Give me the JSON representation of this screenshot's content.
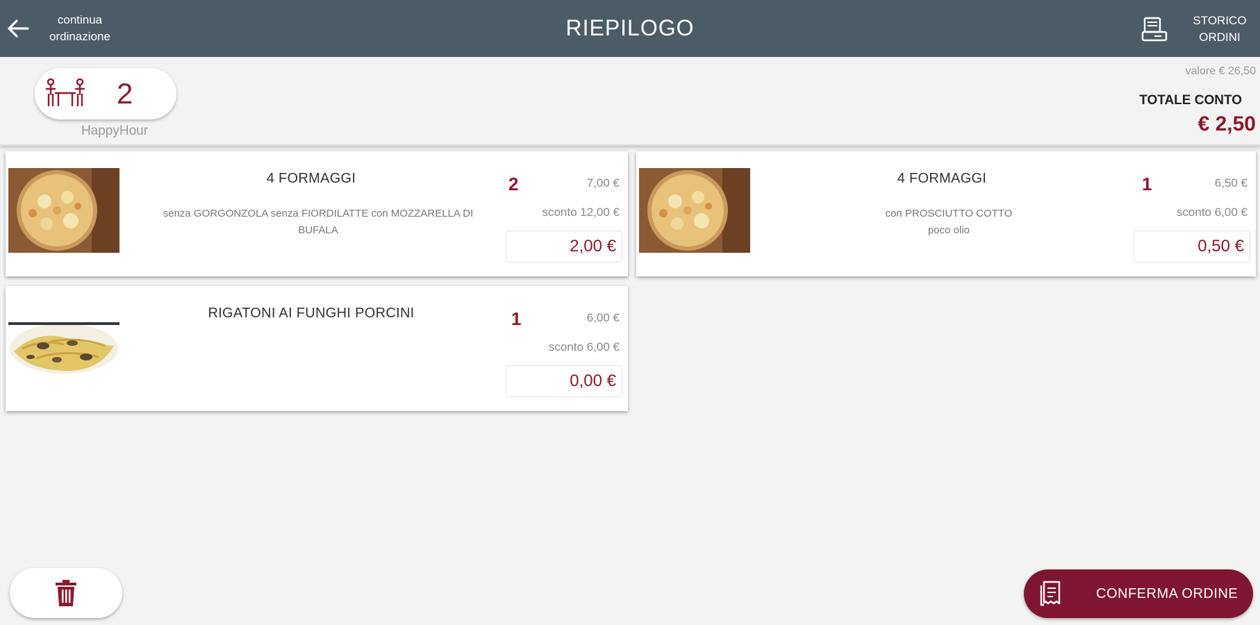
{
  "header": {
    "back_label_line1": "continua",
    "back_label_line2": "ordinazione",
    "title": "RIEPILOGO",
    "history_label_line1": "STORICO",
    "history_label_line2": "ORDINI"
  },
  "table": {
    "guests": "2",
    "group": "HappyHour"
  },
  "summary": {
    "valore": "valore € 26,50",
    "totale_label": "TOTALE CONTO",
    "totale_value": "€ 2,50"
  },
  "items": [
    {
      "name": "4 FORMAGGI",
      "notes_line1": "senza GORGONZOLA senza FIORDILATTE con MOZZARELLA DI",
      "notes_line2": "BUFALA",
      "qty": "2",
      "price": "7,00 €",
      "sconto": "sconto 12,00 €",
      "total": "2,00 €",
      "image": "pizza-image"
    },
    {
      "name": "4 FORMAGGI",
      "notes_line1": "con PROSCIUTTO COTTO",
      "notes_line2": "poco olio",
      "qty": "1",
      "price": "6,50 €",
      "sconto": "sconto 6,00 €",
      "total": "0,50 €",
      "image": "pizza-image"
    },
    {
      "name": "RIGATONI AI FUNGHI PORCINI",
      "notes_line1": "",
      "notes_line2": "",
      "qty": "1",
      "price": "6,00 €",
      "sconto": "sconto 6,00 €",
      "total": "0,00 €",
      "image": "pasta-image"
    }
  ],
  "footer": {
    "delete_icon": "trash-icon",
    "confirm_label": "CONFERMA ORDINE",
    "confirm_icon": "receipt-icon"
  },
  "colors": {
    "header_bg": "#4c5c66",
    "accent": "#8b1a2c",
    "confirm_bg": "#7f1530",
    "page_bg": "#f3f3f3"
  }
}
